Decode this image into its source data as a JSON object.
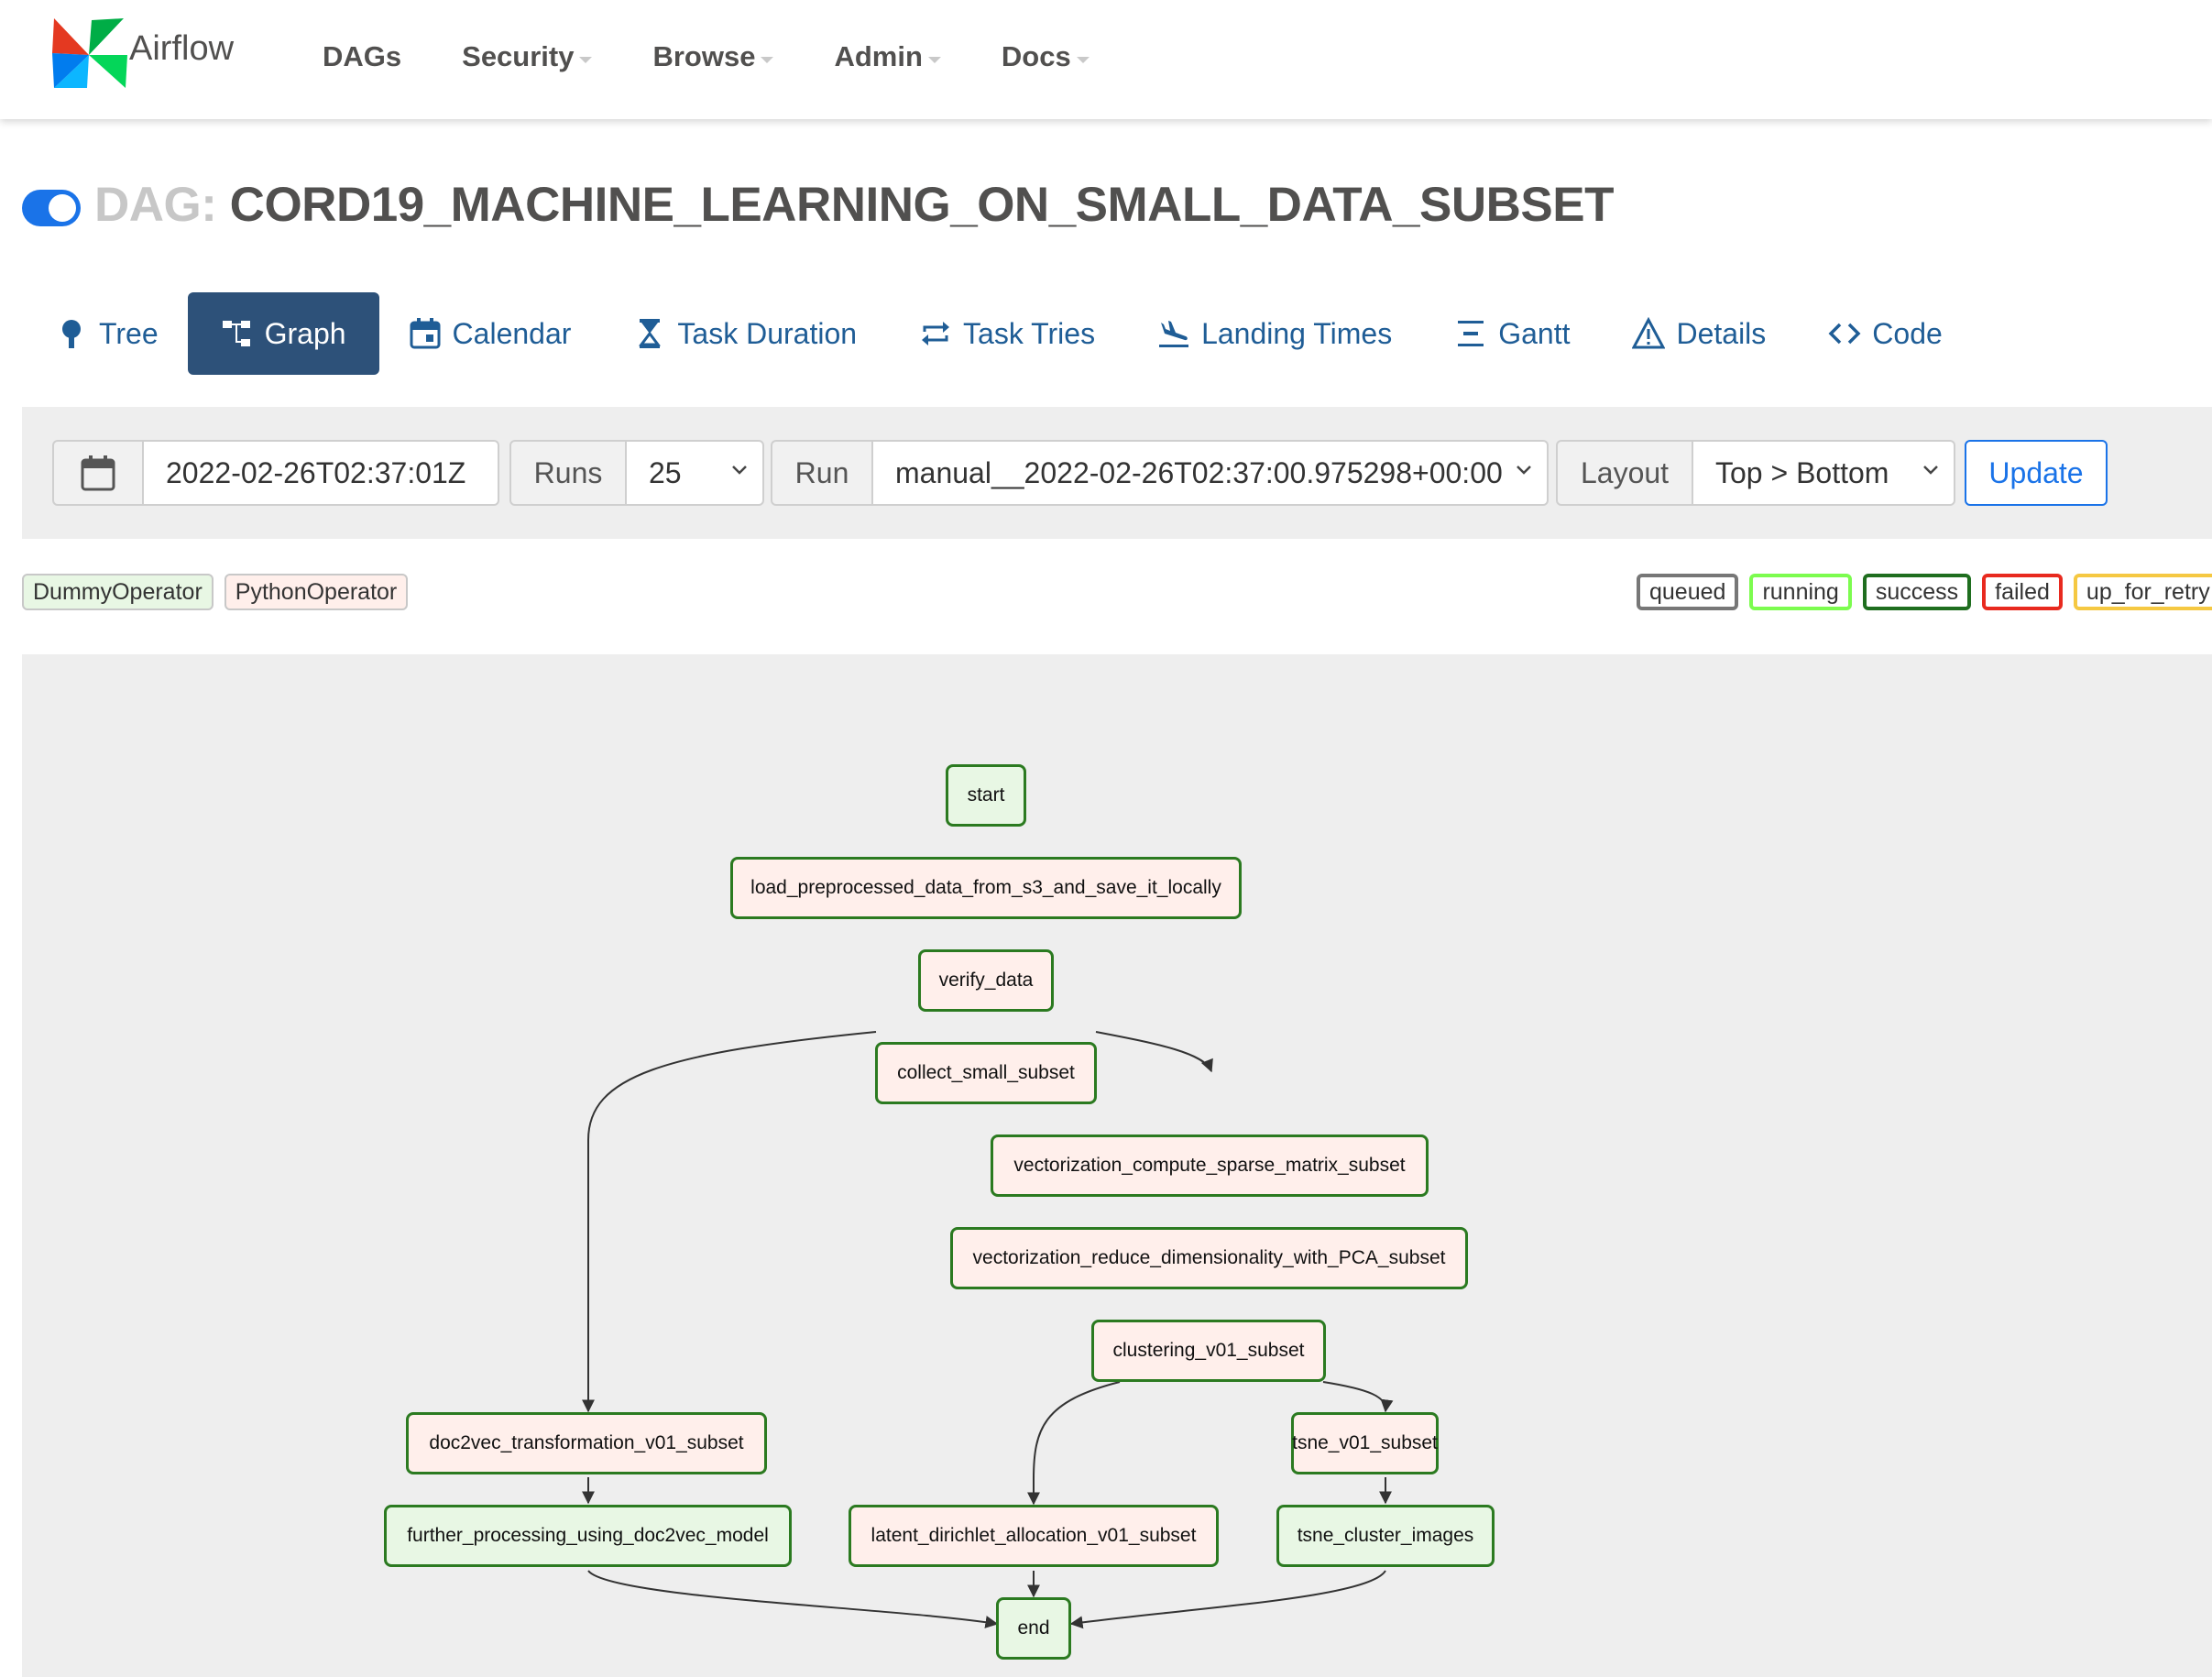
{
  "navbar": {
    "brand": "Airflow",
    "items": [
      "DAGs",
      "Security",
      "Browse",
      "Admin",
      "Docs"
    ]
  },
  "dag": {
    "prefix": "DAG:",
    "name": "CORD19_MACHINE_LEARNING_ON_SMALL_DATA_SUBSET",
    "toggle_on": true
  },
  "tabs": [
    {
      "label": "Tree",
      "icon": "tree-icon"
    },
    {
      "label": "Graph",
      "icon": "graph-icon",
      "active": true
    },
    {
      "label": "Calendar",
      "icon": "calendar-icon"
    },
    {
      "label": "Task Duration",
      "icon": "hourglass-icon"
    },
    {
      "label": "Task Tries",
      "icon": "repeat-icon"
    },
    {
      "label": "Landing Times",
      "icon": "plane-landing-icon"
    },
    {
      "label": "Gantt",
      "icon": "gantt-icon"
    },
    {
      "label": "Details",
      "icon": "warning-triangle-icon"
    },
    {
      "label": "Code",
      "icon": "code-icon"
    }
  ],
  "controls": {
    "base_date": "2022-02-26T02:37:01Z",
    "runs_label": "Runs",
    "runs_value": "25",
    "run_label": "Run",
    "run_value": "manual__2022-02-26T02:37:00.975298+00:00",
    "layout_label": "Layout",
    "layout_value": "Top > Bottom",
    "update_label": "Update"
  },
  "operators": [
    {
      "label": "DummyOperator",
      "color": "#e8f7e4"
    },
    {
      "label": "PythonOperator",
      "color": "#ffefeb"
    }
  ],
  "states": [
    {
      "label": "queued",
      "color": "#808080"
    },
    {
      "label": "running",
      "color": "#00ff00"
    },
    {
      "label": "success",
      "color": "#008000"
    },
    {
      "label": "failed",
      "color": "#ff0000"
    },
    {
      "label": "up_for_retry",
      "color": "#ffd700"
    }
  ],
  "graph": {
    "nodes": {
      "start": {
        "label": "start",
        "operator": "DummyOperator",
        "state": "success"
      },
      "load": {
        "label": "load_preprocessed_data_from_s3_and_save_it_locally",
        "operator": "PythonOperator",
        "state": "success"
      },
      "verify": {
        "label": "verify_data",
        "operator": "PythonOperator",
        "state": "success"
      },
      "collect": {
        "label": "collect_small_subset",
        "operator": "PythonOperator",
        "state": "success"
      },
      "vec_sparse": {
        "label": "vectorization_compute_sparse_matrix_subset",
        "operator": "PythonOperator",
        "state": "success"
      },
      "vec_pca": {
        "label": "vectorization_reduce_dimensionality_with_PCA_subset",
        "operator": "PythonOperator",
        "state": "success"
      },
      "clustering": {
        "label": "clustering_v01_subset",
        "operator": "PythonOperator",
        "state": "success"
      },
      "doc2vec": {
        "label": "doc2vec_transformation_v01_subset",
        "operator": "PythonOperator",
        "state": "success"
      },
      "tsne": {
        "label": "tsne_v01_subset",
        "operator": "PythonOperator",
        "state": "success"
      },
      "further": {
        "label": "further_processing_using_doc2vec_model",
        "operator": "DummyOperator",
        "state": "success"
      },
      "lda": {
        "label": "latent_dirichlet_allocation_v01_subset",
        "operator": "PythonOperator",
        "state": "success"
      },
      "tsne_images": {
        "label": "tsne_cluster_images",
        "operator": "DummyOperator",
        "state": "success"
      },
      "end": {
        "label": "end",
        "operator": "DummyOperator",
        "state": "success"
      }
    },
    "edges": [
      [
        "start",
        "load"
      ],
      [
        "load",
        "verify"
      ],
      [
        "verify",
        "collect"
      ],
      [
        "collect",
        "vec_sparse"
      ],
      [
        "collect",
        "doc2vec"
      ],
      [
        "vec_sparse",
        "vec_pca"
      ],
      [
        "vec_pca",
        "clustering"
      ],
      [
        "clustering",
        "lda"
      ],
      [
        "clustering",
        "tsne"
      ],
      [
        "doc2vec",
        "further"
      ],
      [
        "tsne",
        "tsne_images"
      ],
      [
        "further",
        "end"
      ],
      [
        "lda",
        "end"
      ],
      [
        "tsne_images",
        "end"
      ]
    ]
  }
}
